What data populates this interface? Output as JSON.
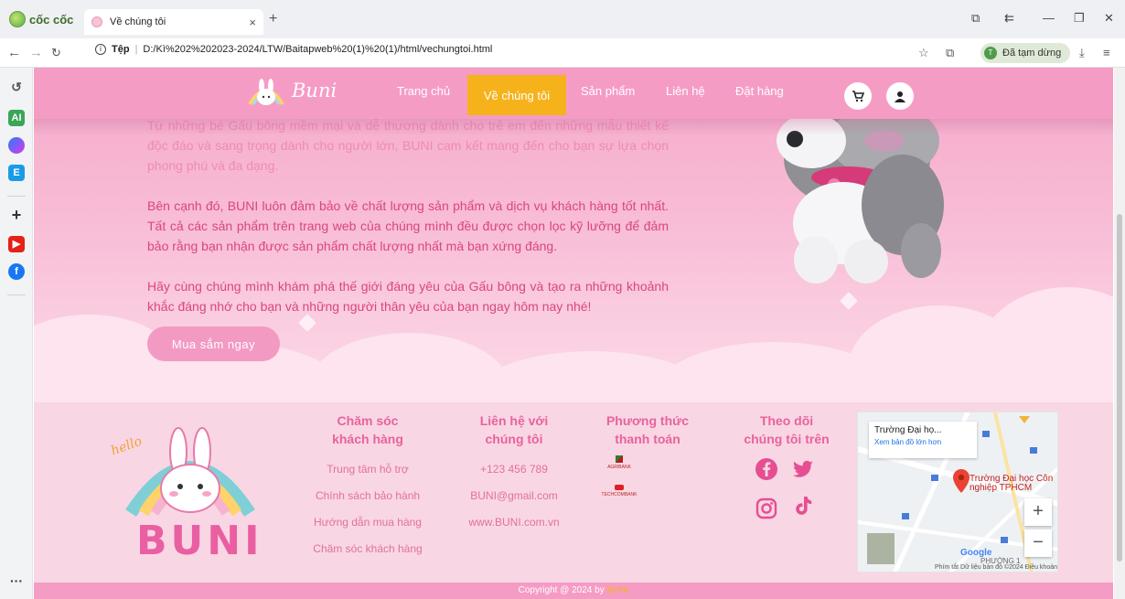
{
  "browser": {
    "brand": "cốc cốc",
    "tab_title": "Về chúng tôi",
    "tab_close": "×",
    "new_tab": "+",
    "url_prefix": "Tệp",
    "url": "D:/Kì%202%202023-2024/LTW/Baitapweb%20(1)%20(1)/html/vechungtoi.html",
    "profile_initial": "T",
    "profile_status": "Đã tạm dừng"
  },
  "nav": {
    "logo_text": "Buni",
    "items": [
      {
        "label": "Trang chủ"
      },
      {
        "label": "Về chúng tôi",
        "active": true
      },
      {
        "label": "Sản phẩm"
      },
      {
        "label": "Liên hệ"
      },
      {
        "label": "Đặt hàng"
      }
    ],
    "icons": [
      "cart-icon",
      "user-icon"
    ]
  },
  "hero": {
    "paragraph_1_tail": "Từ những bé Gấu bông mềm mại và dễ thương dành cho trẻ em đến những mẫu thiết kế độc đáo và sang trọng dành cho người lớn, BUNI cam kết mang đến cho bạn sự lựa chọn phong phú và đa dạng.",
    "paragraph_2": "Bên cạnh đó, BUNI luôn đảm bảo về chất lượng sản phẩm và dịch vụ khách hàng tốt nhất. Tất cả các sản phẩm trên trang web của chúng mình đều được chọn lọc kỹ lưỡng để đảm bảo rằng bạn nhận được sản phẩm chất lượng nhất mà bạn xứng đáng.",
    "paragraph_3": "Hãy cùng chúng mình khám phá thế giới đáng yêu của Gấu bông và tạo ra những khoảnh khắc đáng nhớ cho bạn và những người thân yêu của bạn ngay hôm nay nhé!",
    "cta": "Mua sắm ngay"
  },
  "footer": {
    "logo_caption": "hello",
    "logo_word": "BUNI",
    "care": {
      "title_1": "Chăm sóc",
      "title_2": "khách hàng",
      "items": [
        "Trung tâm hỗ trợ",
        "Chính sách bảo hành",
        "Hướng dẫn mua hàng",
        "Chăm sóc khách hàng"
      ]
    },
    "contact": {
      "title_1": "Liên hệ với",
      "title_2": "chúng tôi",
      "items": [
        "+123 456 789",
        "BUNI@gmail.com",
        "www.BUNI.com.vn"
      ]
    },
    "payment": {
      "title_1": "Phương thức",
      "title_2": "thanh toán",
      "banks": [
        "AGRIBANK",
        "TECHCOMBANK"
      ]
    },
    "follow": {
      "title_1": "Theo dõi",
      "title_2": "chúng tôi trên",
      "icons": [
        "facebook-icon",
        "twitter-icon",
        "instagram-icon",
        "tiktok-icon"
      ]
    },
    "map": {
      "card_title": "Trường Đại họ...",
      "card_link": "Xem bản đồ lớn hơn",
      "pin_label_1": "Trường Đại học Côn",
      "pin_label_2": "nghiệp TPHCM",
      "district": "PHƯỜNG 1",
      "google": "Google",
      "attribution": "Phím tắt   Dữ liệu bản đồ ©2024   Điều khoản",
      "zoom_in": "+",
      "zoom_out": "−"
    },
    "copyright_text": "Copyright @ 2024 by",
    "copyright_brand": "BUNI"
  }
}
